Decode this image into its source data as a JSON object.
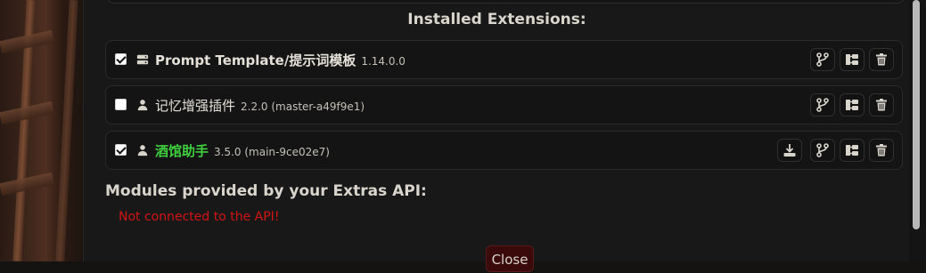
{
  "extensions_title": "Installed Extensions:",
  "extensions": [
    {
      "name": "Prompt Template/提示词模板",
      "version": "1.14.0.0",
      "enabled": true,
      "icon": "server-icon",
      "name_color": "#e4e0d8"
    },
    {
      "name": "记忆增强插件",
      "version": "2.2.0 (master-a49f9e1)",
      "enabled": false,
      "icon": "user-icon",
      "name_color": "#e4e0d8"
    },
    {
      "name": "酒馆助手",
      "version": "3.5.0 (main-9ce02e7)",
      "enabled": true,
      "icon": "user-icon",
      "name_color": "#3fd13f"
    }
  ],
  "modules_title": "Modules provided by your Extras API:",
  "api_status": "Not connected to the API!",
  "close_label": "Close",
  "colors": {
    "error": "#d11414",
    "accent_green": "#3fd13f",
    "close_bg": "#3a0a0a"
  }
}
